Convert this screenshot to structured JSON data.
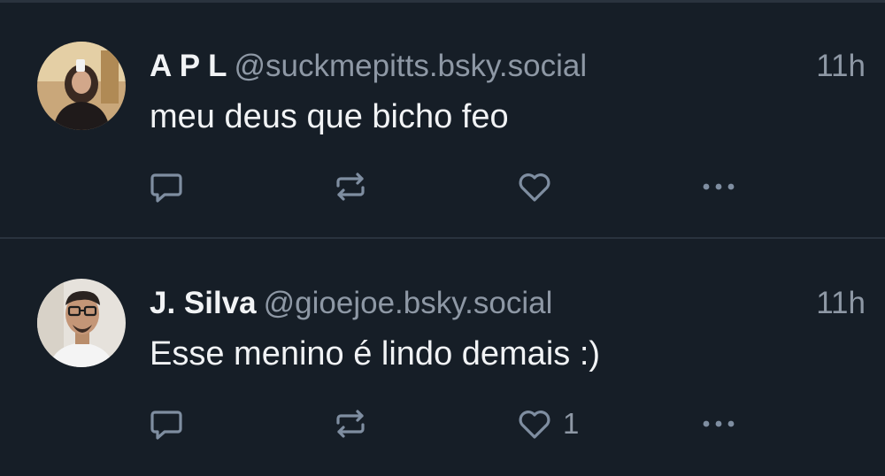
{
  "posts": [
    {
      "display_name": "A P L",
      "handle": "@suckmepitts.bsky.social",
      "time": "11h",
      "text": "meu deus que bicho feo",
      "avatar_icon": "user-avatar-photo",
      "like_count": ""
    },
    {
      "display_name": "J. Silva",
      "handle": "@gioejoe.bsky.social",
      "time": "11h",
      "text": "Esse menino é lindo demais :)",
      "avatar_icon": "user-avatar-photo",
      "like_count": "1"
    }
  ],
  "icons": {
    "reply": "reply-icon",
    "repost": "repost-icon",
    "like": "heart-icon",
    "more": "more-options-icon"
  },
  "colors": {
    "background": "#161e27",
    "divider": "#2a333e",
    "text_primary": "#f1f3f5",
    "text_secondary": "#8e98a5",
    "icon": "#7f8ea1"
  }
}
